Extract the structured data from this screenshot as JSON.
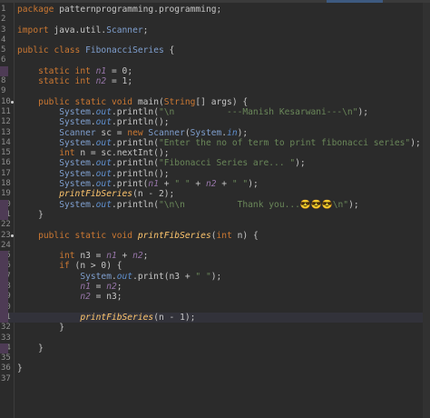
{
  "editor": {
    "lines": [
      {
        "n": "1",
        "code": "package patternprogramming.programming;"
      },
      {
        "n": "2",
        "code": ""
      },
      {
        "n": "3",
        "code": "import java.util.Scanner;"
      },
      {
        "n": "4",
        "code": ""
      },
      {
        "n": "5",
        "code": "public class FibonacciSeries {"
      },
      {
        "n": "6",
        "code": ""
      },
      {
        "n": "7",
        "code": "    static int n1 = 0;"
      },
      {
        "n": "8",
        "code": "    static int n2 = 1;"
      },
      {
        "n": "9",
        "code": ""
      },
      {
        "n": "10",
        "code": "    public static void main(String[] args) {"
      },
      {
        "n": "11",
        "code": "        System.out.println(\"\\n          ---Manish Kesarwani---\\n\");"
      },
      {
        "n": "12",
        "code": "        System.out.println();"
      },
      {
        "n": "13",
        "code": "        Scanner sc = new Scanner(System.in);"
      },
      {
        "n": "14",
        "code": "        System.out.println(\"Enter the no of term to print fibonacci series\");"
      },
      {
        "n": "15",
        "code": "        int n = sc.nextInt();"
      },
      {
        "n": "16",
        "code": "        System.out.println(\"Fibonacci Series are... \");"
      },
      {
        "n": "17",
        "code": "        System.out.println();"
      },
      {
        "n": "18",
        "code": "        System.out.print(n1 + \" \" + n2 + \" \");"
      },
      {
        "n": "19",
        "code": "        printFibSeries(n - 2);"
      },
      {
        "n": "20",
        "code": "        System.out.println(\"\\n\\n          Thank you...😎😎😎\\n\");"
      },
      {
        "n": "21",
        "code": "    }"
      },
      {
        "n": "22",
        "code": ""
      },
      {
        "n": "23",
        "code": "    public static void printFibSeries(int n) {"
      },
      {
        "n": "24",
        "code": ""
      },
      {
        "n": "25",
        "code": "        int n3 = n1 + n2;"
      },
      {
        "n": "26",
        "code": "        if (n > 0) {"
      },
      {
        "n": "27",
        "code": "            System.out.print(n3 + \" \");"
      },
      {
        "n": "28",
        "code": "            n1 = n2;"
      },
      {
        "n": "29",
        "code": "            n2 = n3;"
      },
      {
        "n": "30",
        "code": ""
      },
      {
        "n": "31",
        "code": "            printFibSeries(n - 1);"
      },
      {
        "n": "32",
        "code": "        }"
      },
      {
        "n": "33",
        "code": ""
      },
      {
        "n": "34",
        "code": "    }"
      },
      {
        "n": "35",
        "code": ""
      },
      {
        "n": "36",
        "code": "}"
      },
      {
        "n": "37",
        "code": ""
      }
    ]
  },
  "colors": {
    "background": "#2b2b2b",
    "keyword": "#cc7832",
    "field": "#9876aa",
    "string": "#6a8759",
    "method": "#ffc66d"
  }
}
